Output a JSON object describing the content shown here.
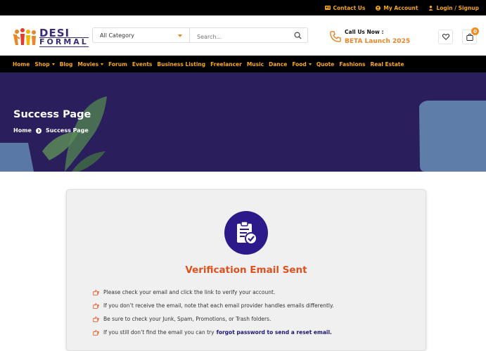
{
  "topbar": {
    "contact": "Contact Us",
    "account": "My Account",
    "login": "Login / Signup"
  },
  "header": {
    "logo_line1": "DESI",
    "logo_line2": "FORMAL",
    "category": "All Category",
    "search_placeholder": "Search...",
    "call_label": "Call Us Now :",
    "call_value": "BETA Launch 2025",
    "cart_count": "0"
  },
  "nav": {
    "items": [
      {
        "label": "Home"
      },
      {
        "label": "Shop",
        "dropdown": true
      },
      {
        "label": "Blog"
      },
      {
        "label": "Movies",
        "dropdown": true
      },
      {
        "label": "Forum"
      },
      {
        "label": "Events"
      },
      {
        "label": "Business Listing"
      },
      {
        "label": "Freelancer"
      },
      {
        "label": "Music"
      },
      {
        "label": "Dance"
      },
      {
        "label": "Food",
        "dropdown": true
      },
      {
        "label": "Quote"
      },
      {
        "label": "Fashions"
      },
      {
        "label": "Real Estate"
      }
    ]
  },
  "hero": {
    "title": "Success Page",
    "breadcrumb_home": "Home",
    "breadcrumb_current": "Success Page"
  },
  "verification": {
    "title": "Verification Email Sent",
    "items": [
      "Please check your email and click the link to verify your account.",
      "If you don’t receive the email, note that each email provider handles emails differently.",
      "Be sure to check your Junk, Spam, Promotions, or Trash folders.",
      "If you still don’t find the email you can try"
    ],
    "reset_link": "forgot password to send a reset email."
  },
  "colors": {
    "accent": "#f5a623",
    "brand": "#2d1a8a",
    "title": "#e0501f",
    "hero_bg": "#2a1f5c"
  }
}
